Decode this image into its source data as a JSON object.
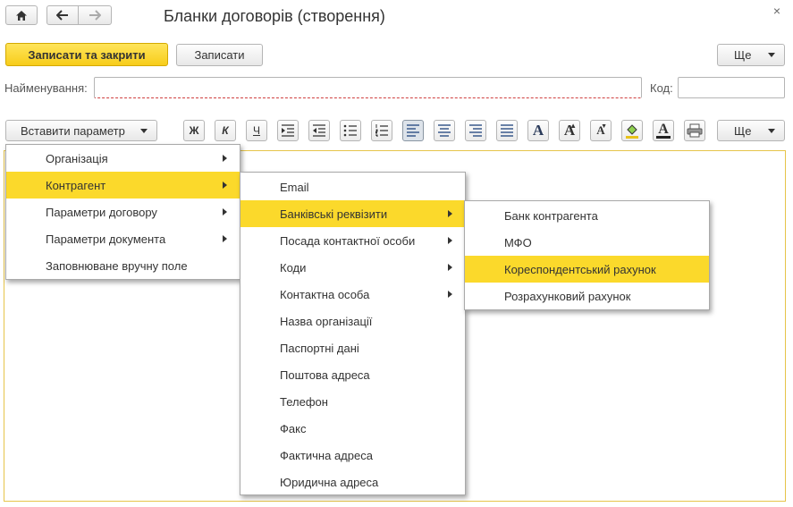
{
  "window": {
    "title": "Бланки договорів (створення)",
    "close_glyph": "×"
  },
  "nav": {
    "home_icon": "home-icon",
    "back_icon": "arrow-left-icon",
    "forward_icon": "arrow-right-icon"
  },
  "actions": {
    "save_close": "Записати та закрити",
    "save": "Записати",
    "more": "Ще"
  },
  "form": {
    "name_label": "Найменування:",
    "name_value": "",
    "code_label": "Код:",
    "code_value": ""
  },
  "toolbar": {
    "insert_param": "Вставити параметр",
    "bold": "Ж",
    "italic": "К",
    "underline": "Ч",
    "font_glyph": "A",
    "more": "Ще"
  },
  "menus": {
    "level1": [
      {
        "label": "Організація",
        "submenu": true
      },
      {
        "label": "Контрагент",
        "submenu": true
      },
      {
        "label": "Параметри договору",
        "submenu": true
      },
      {
        "label": "Параметри документа",
        "submenu": true
      },
      {
        "label": "Заповнюване вручну поле",
        "submenu": false
      }
    ],
    "level2": [
      {
        "label": "Email",
        "submenu": false
      },
      {
        "label": "Банківські реквізити",
        "submenu": true
      },
      {
        "label": "Посада контактної особи",
        "submenu": true
      },
      {
        "label": "Коди",
        "submenu": true
      },
      {
        "label": "Контактна особа",
        "submenu": true
      },
      {
        "label": "Назва організації",
        "submenu": false
      },
      {
        "label": "Паспортні дані",
        "submenu": false
      },
      {
        "label": "Поштова адреса",
        "submenu": false
      },
      {
        "label": "Телефон",
        "submenu": false
      },
      {
        "label": "Факс",
        "submenu": false
      },
      {
        "label": "Фактична адреса",
        "submenu": false
      },
      {
        "label": "Юридична адреса",
        "submenu": false
      }
    ],
    "level3": [
      {
        "label": "Банк контрагента"
      },
      {
        "label": "МФО"
      },
      {
        "label": "Кореспондентський рахунок"
      },
      {
        "label": "Розрахунковий рахунок"
      }
    ]
  },
  "colors": {
    "highlight": "#fbd92b",
    "primary_button": "#f7cd1a",
    "editor_border": "#e6c44a"
  }
}
